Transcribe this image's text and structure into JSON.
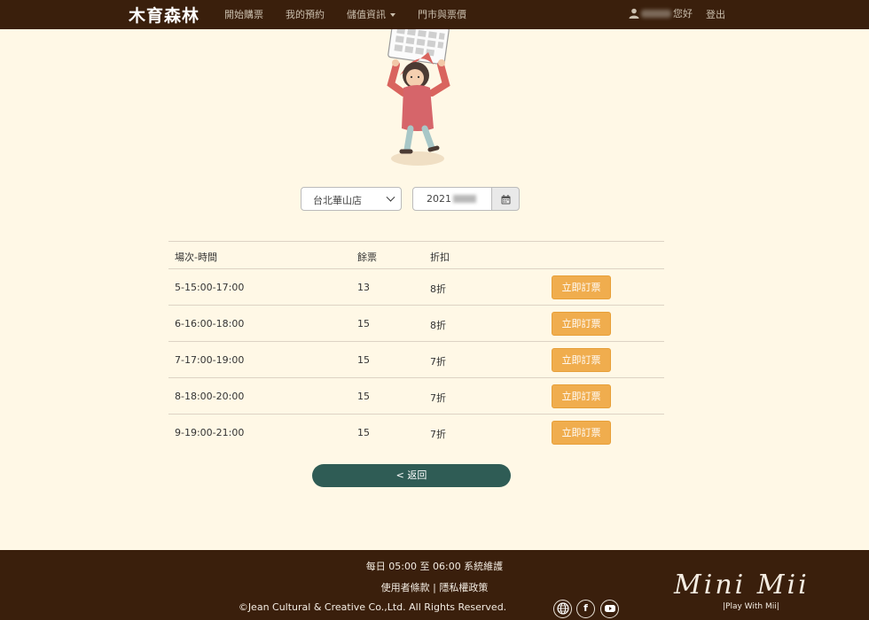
{
  "nav": {
    "brand": "木育森林",
    "items": [
      "開始購票",
      "我的預約",
      "儲值資訊",
      "門市與票價"
    ],
    "greeting": "您好",
    "logout": "登出"
  },
  "filters": {
    "store": "台北華山店",
    "date_prefix": "2021"
  },
  "table": {
    "headers": [
      "場次-時間",
      "餘票",
      "折扣"
    ],
    "rows": [
      {
        "session": "5-15:00-17:00",
        "remaining": "13",
        "discount": "8折",
        "action": "立即訂票"
      },
      {
        "session": "6-16:00-18:00",
        "remaining": "15",
        "discount": "8折",
        "action": "立即訂票"
      },
      {
        "session": "7-17:00-19:00",
        "remaining": "15",
        "discount": "7折",
        "action": "立即訂票"
      },
      {
        "session": "8-18:00-20:00",
        "remaining": "15",
        "discount": "7折",
        "action": "立即訂票"
      },
      {
        "session": "9-19:00-21:00",
        "remaining": "15",
        "discount": "7折",
        "action": "立即訂票"
      }
    ]
  },
  "back_button": "< 返回",
  "footer": {
    "maintenance": "每日 05:00 至 06:00 系統維護",
    "terms": "使用者條款",
    "separator": "|",
    "privacy": "隱私權政策",
    "copyright": "©Jean Cultural & Creative Co.,Ltd. All Rights Reserved.",
    "logo_text": "Mini Mii",
    "tagline": "|Play With Mii|"
  },
  "icons": [
    "user-icon",
    "calendar-icon",
    "globe-icon",
    "facebook-icon",
    "youtube-icon"
  ],
  "colors": {
    "nav_bg": "#3a1f0c",
    "page_bg": "#fff8e6",
    "book_button": "#f0ad4e",
    "back_button": "#2f5c55"
  }
}
